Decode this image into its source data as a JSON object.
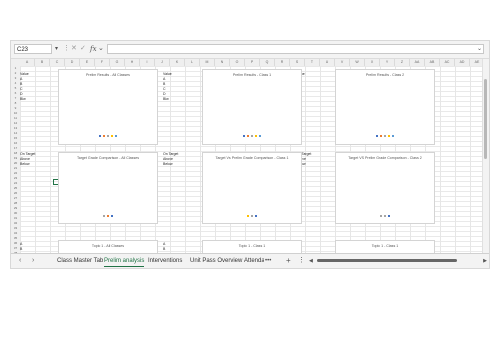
{
  "formula_bar": {
    "name_box": "C23",
    "cancel_icon": "close-icon",
    "enter_icon": "check-icon",
    "fx_label": "fx",
    "formula": ""
  },
  "columns": [
    "A",
    "B",
    "C",
    "D",
    "E",
    "F",
    "G",
    "H",
    "I",
    "J",
    "K",
    "L",
    "M",
    "N",
    "O",
    "P",
    "Q",
    "R",
    "S",
    "T",
    "U",
    "V",
    "W",
    "X",
    "Y",
    "Z",
    "AA",
    "AB",
    "AC",
    "AD",
    "AE",
    "AF",
    "AG"
  ],
  "rows": [
    "1",
    "2",
    "3",
    "4",
    "5",
    "6",
    "7",
    "8",
    "9",
    "10",
    "11",
    "12",
    "13",
    "14",
    "15",
    "16",
    "17",
    "18",
    "19",
    "20",
    "21",
    "22",
    "23",
    "24",
    "25",
    "26",
    "27",
    "28",
    "29",
    "30",
    "31",
    "32",
    "33",
    "34",
    "35",
    "36",
    "37",
    "38"
  ],
  "cells": {
    "blockA": {
      "header": "Value",
      "items": [
        "A",
        "B",
        "C",
        "D",
        "Blw"
      ]
    },
    "blockB": {
      "header": "Value",
      "items": [
        "A",
        "B",
        "C",
        "D",
        "Blw"
      ]
    },
    "blockC": {
      "header": "Value",
      "items": [
        "A",
        "B",
        "C",
        "D",
        "Blw"
      ]
    },
    "targetA": [
      "On Target",
      "Above",
      "Below"
    ],
    "targetB": [
      "On Target",
      "Above",
      "Below"
    ],
    "targetC": [
      "On Target",
      "Above",
      "Below"
    ],
    "bottomA": [
      "A",
      "B",
      "C"
    ],
    "bottomB": [
      "A",
      "B",
      "C"
    ],
    "bottomC": [
      "A",
      "B",
      "C"
    ]
  },
  "charts": {
    "c1": {
      "title": "Prelim Results - All Classes"
    },
    "c2": {
      "title": "Prelim Results - Class 1"
    },
    "c3": {
      "title": "Prelim Results - Class 2"
    },
    "c4": {
      "title": "Target Grade Comparison - All Classes"
    },
    "c5": {
      "title": "Target Vs Prelim Grade Comparison - Class 1"
    },
    "c6": {
      "title": "Target VS Prelim Grade Comparison - Class 2"
    },
    "c7": {
      "title": "Topic 1 - All Classes"
    },
    "c8": {
      "title": "Topic 1 - Class 1"
    },
    "c9": {
      "title": "Topic 1 - Class 1"
    }
  },
  "colors": {
    "accent": "#217346",
    "a": "#4472c4",
    "b": "#ed7d31",
    "c": "#a5a5a5",
    "d": "#ffc000",
    "e": "#5b9bd5"
  },
  "sheet_tabs": [
    "Class Master Tab",
    "Prelim analysis",
    "Interventions",
    "Unit Pass Overview",
    "Attendance"
  ],
  "active_tab": "Prelim analysis",
  "tab_more": "•••",
  "tab_add": "+",
  "tab_options": "⋮"
}
